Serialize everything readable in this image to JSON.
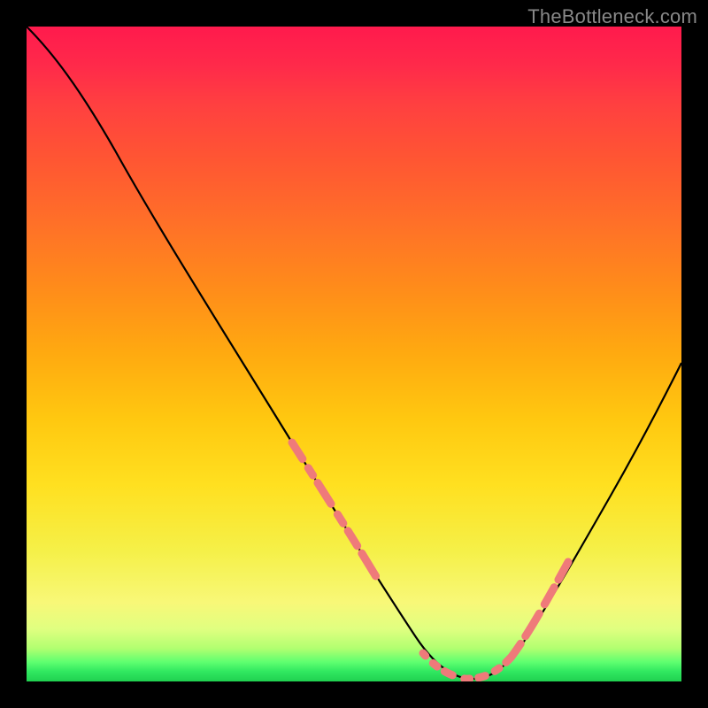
{
  "watermark": "TheBottleneck.com",
  "chart_data": {
    "type": "line",
    "title": "",
    "xlabel": "",
    "ylabel": "",
    "xlim": [
      0,
      100
    ],
    "ylim": [
      0,
      100
    ],
    "grid": false,
    "series": [
      {
        "name": "main-curve",
        "x": [
          0,
          4,
          10,
          18,
          26,
          34,
          40,
          45,
          50,
          55,
          59,
          63,
          67,
          70,
          73,
          77,
          82,
          88,
          94,
          100
        ],
        "y": [
          100,
          96,
          90,
          80,
          69,
          57,
          47,
          38,
          28,
          17,
          8,
          3,
          1,
          1,
          3,
          8,
          15,
          24,
          34,
          45
        ]
      },
      {
        "name": "highlight-left",
        "x": [
          40,
          45,
          50,
          55,
          59
        ],
        "y": [
          47,
          38,
          28,
          17,
          8
        ],
        "style": "dashed-pink"
      },
      {
        "name": "highlight-bottom",
        "x": [
          59,
          63,
          67,
          70,
          73
        ],
        "y": [
          8,
          3,
          1,
          1,
          3
        ],
        "style": "dotted-pink"
      },
      {
        "name": "highlight-right",
        "x": [
          73,
          77,
          82
        ],
        "y": [
          3,
          8,
          15
        ],
        "style": "dashed-pink"
      }
    ],
    "colors": {
      "curve": "#000000",
      "highlight": "#ef7a7a",
      "background_top": "#ff1a4d",
      "background_bottom": "#20d050",
      "frame": "#000000"
    }
  }
}
